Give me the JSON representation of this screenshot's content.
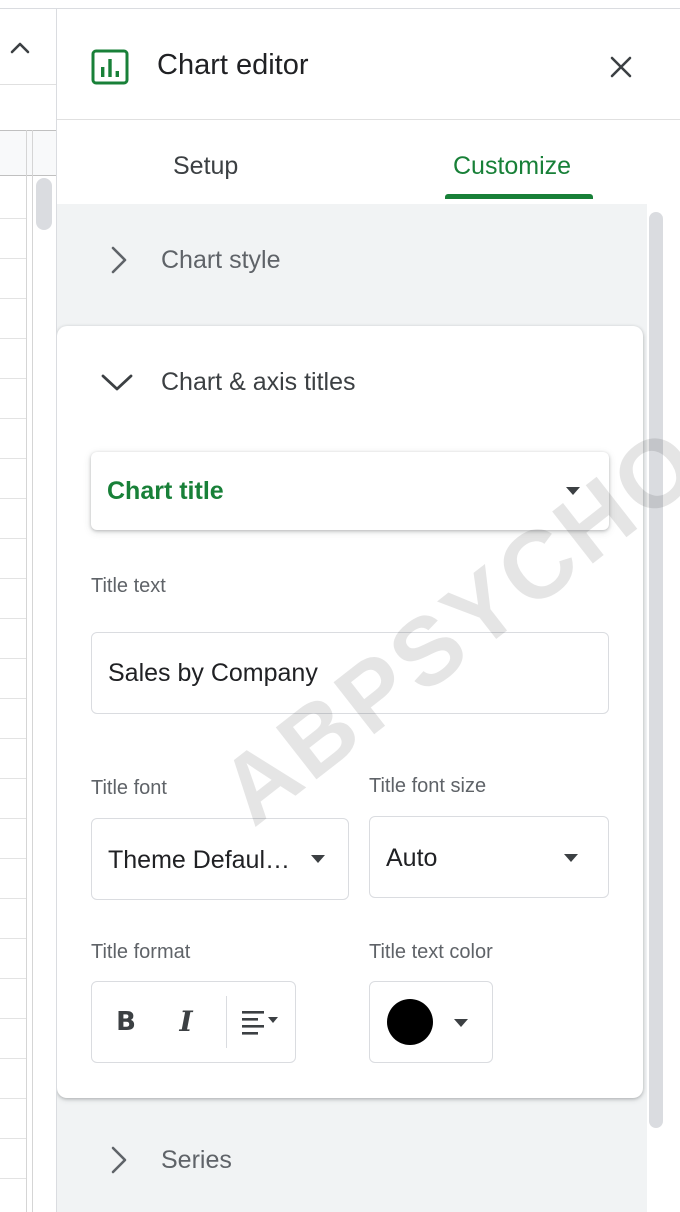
{
  "panel": {
    "title": "Chart editor",
    "tabs": [
      {
        "label": "Setup",
        "active": false
      },
      {
        "label": "Customize",
        "active": true
      }
    ]
  },
  "sections": {
    "chart_style": "Chart style",
    "chart_axis_titles": "Chart & axis titles",
    "series": "Series"
  },
  "titles": {
    "target_selected": "Chart title",
    "title_text_label": "Title text",
    "title_text_value": "Sales by Company",
    "title_font_label": "Title font",
    "title_font_value": "Theme Defaul…",
    "title_font_size_label": "Title font size",
    "title_font_size_value": "Auto",
    "title_format_label": "Title format",
    "format_bold": "B",
    "format_italic": "I",
    "title_text_color_label": "Title text color",
    "title_text_color": "#000000"
  },
  "colors": {
    "accent_green": "#188038",
    "muted_text": "#5f6368",
    "border": "#dadce0"
  },
  "watermark": "ABPSYCHO"
}
